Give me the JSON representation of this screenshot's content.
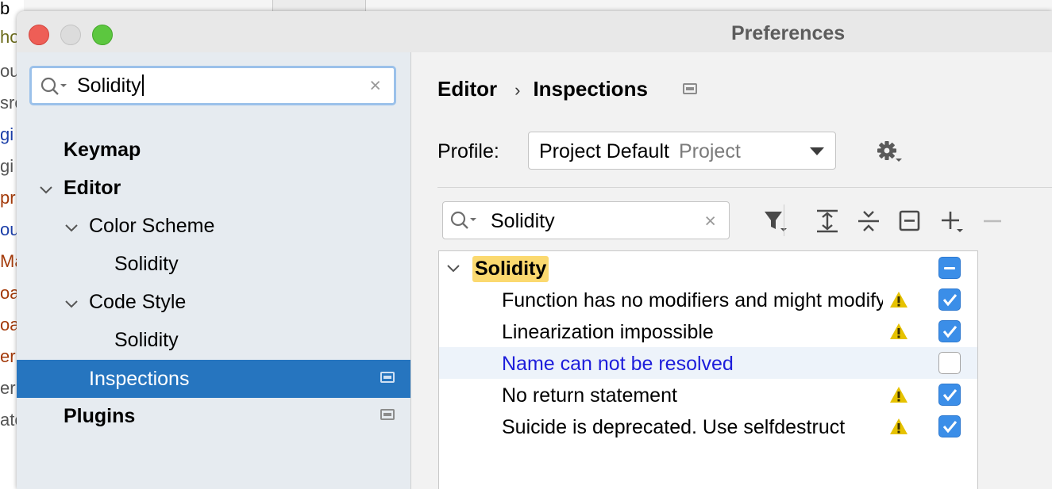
{
  "background": {
    "fragments": [
      "b",
      "ho",
      "ou",
      "sro",
      "gi",
      "gi",
      "pr",
      "ou",
      "Ma",
      "oa",
      "oa",
      "er",
      "ern",
      "ate"
    ],
    "fragment_colors": [
      "#000000",
      "#6b6b1a",
      "#555555",
      "#555555",
      "#1c3fa8",
      "#555555",
      "#a33a0a",
      "#1c3fa8",
      "#a33a0a",
      "#a33a0a",
      "#a33a0a",
      "#a33a0a",
      "#555555",
      "#555555"
    ]
  },
  "window": {
    "title": "Preferences"
  },
  "sidebar": {
    "search": {
      "value": "Solidity",
      "clear_glyph": "×"
    },
    "items": [
      {
        "label": "Keymap"
      },
      {
        "label": "Editor"
      },
      {
        "label": "Color Scheme"
      },
      {
        "label": "Solidity"
      },
      {
        "label": "Code Style"
      },
      {
        "label": "Solidity"
      },
      {
        "label": "Inspections"
      },
      {
        "label": "Plugins"
      }
    ]
  },
  "content": {
    "breadcrumb": {
      "root": "Editor",
      "separator": "›",
      "current": "Inspections"
    },
    "profile": {
      "label": "Profile:",
      "value": "Project Default",
      "scope": "Project"
    },
    "filter": {
      "value": "Solidity",
      "clear_glyph": "×"
    },
    "tree": {
      "group": "Solidity",
      "group_state": "partial",
      "rows": [
        {
          "text": "Function has no modifiers and might modify",
          "warning": true,
          "checked": true,
          "highlight": false,
          "link": false
        },
        {
          "text": "Linearization impossible",
          "warning": true,
          "checked": true,
          "highlight": false,
          "link": false
        },
        {
          "text": "Name can not be resolved",
          "warning": false,
          "checked": false,
          "highlight": true,
          "link": true
        },
        {
          "text": "No return statement",
          "warning": true,
          "checked": true,
          "highlight": false,
          "link": false
        },
        {
          "text": "Suicide is deprecated. Use selfdestruct",
          "warning": true,
          "checked": true,
          "highlight": false,
          "link": false
        }
      ]
    }
  },
  "colors": {
    "selection": "#2675bf",
    "search_highlight": "#fbd96f",
    "link": "#1d1ddb",
    "checkbox": "#3b8ee8",
    "warning": "#e6c200"
  }
}
